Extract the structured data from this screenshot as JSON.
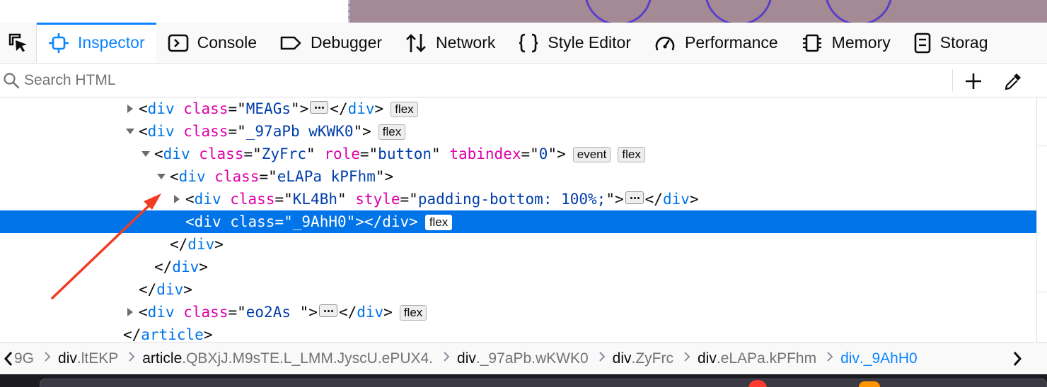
{
  "toolbar": {
    "tabs": [
      {
        "label": "Inspector",
        "icon": "inspector-icon"
      },
      {
        "label": "Console",
        "icon": "console-icon"
      },
      {
        "label": "Debugger",
        "icon": "debugger-icon"
      },
      {
        "label": "Network",
        "icon": "network-icon"
      },
      {
        "label": "Style Editor",
        "icon": "braces-icon"
      },
      {
        "label": "Performance",
        "icon": "gauge-icon"
      },
      {
        "label": "Memory",
        "icon": "chip-icon"
      },
      {
        "label": "Storag",
        "icon": "storage-icon"
      }
    ],
    "selected_tab": "Inspector"
  },
  "search": {
    "placeholder": "Search HTML",
    "value": ""
  },
  "markup": {
    "rows": [
      {
        "parts": [
          "<",
          "div",
          " ",
          "class",
          "=\"",
          "MEAGs",
          "\"",
          ">",
          "",
          "</",
          "div",
          ">"
        ],
        "badges": [
          "flex"
        ]
      },
      {
        "parts": [
          "<",
          "div",
          " ",
          "class",
          "=\"",
          "_97aPb wKWK0",
          "\"",
          ">"
        ],
        "badges": [
          "flex"
        ]
      },
      {
        "parts": [
          "<",
          "div",
          " ",
          "class",
          "=\"",
          "ZyFrc",
          "\"",
          " ",
          "role",
          "=\"",
          "button",
          "\"",
          " ",
          "tabindex",
          "=\"",
          "0",
          "\"",
          ">"
        ],
        "badges": [
          "event",
          "flex"
        ]
      },
      {
        "parts": [
          "<",
          "div",
          " ",
          "class",
          "=\"",
          "eLAPa kPFhm",
          "\"",
          ">"
        ],
        "badges": []
      },
      {
        "parts": [
          "<",
          "div",
          " ",
          "class",
          "=\"",
          "KL4Bh",
          "\"",
          " ",
          "style",
          "=\"",
          "padding-bottom: 100%;",
          "\"",
          ">",
          "",
          "</",
          "div",
          ">"
        ],
        "badges": []
      },
      {
        "parts": [
          "<",
          "div",
          " ",
          "class",
          "=\"",
          "_9AhH0",
          "\"",
          "></",
          "div",
          ">"
        ],
        "badges": [
          "flex"
        ]
      },
      {
        "parts": [
          "</",
          "div",
          ">"
        ],
        "badges": []
      },
      {
        "parts": [
          "</",
          "div",
          ">"
        ],
        "badges": []
      },
      {
        "parts": [
          "</",
          "div",
          ">"
        ],
        "badges": []
      },
      {
        "parts": [
          "<",
          "div",
          " ",
          "class",
          "=\"",
          "eo2As ",
          "\"",
          ">",
          "",
          "</",
          "div",
          ">"
        ],
        "badges": [
          "flex"
        ]
      },
      {
        "parts": [
          "</",
          "article",
          ">"
        ],
        "badges": []
      }
    ],
    "selected_row": 5
  },
  "breadcrumbs": {
    "items": [
      {
        "tag": "",
        "cls": "9G"
      },
      {
        "tag": "div",
        "cls": ".ltEKP"
      },
      {
        "tag": "article",
        "cls": ".QBXjJ.M9sTE.L_LMM.JyscU.ePUX4."
      },
      {
        "tag": "div",
        "cls": "._97aPb.wKWK0"
      },
      {
        "tag": "div",
        "cls": ".ZyFrc"
      },
      {
        "tag": "div",
        "cls": ".eLAPa.kPFhm"
      },
      {
        "tag": "div",
        "cls": "._9AhH0"
      }
    ],
    "selected_index": 6
  },
  "colors": {
    "accent": "#0a84ff",
    "selection": "#0074e8",
    "tag": "#0074e8",
    "attr_name": "#dd00a9",
    "attr_value": "#003eaa",
    "annotation_arrow": "#f03c22"
  }
}
